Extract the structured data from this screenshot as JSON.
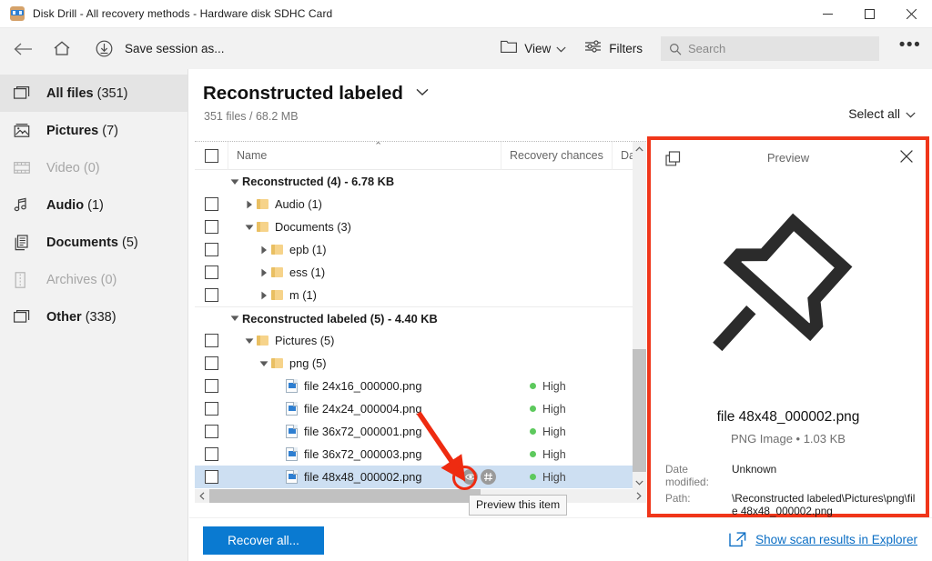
{
  "window": {
    "title": "Disk Drill - All recovery methods - Hardware disk SDHC Card",
    "app_icon": "disk-drill-icon",
    "minimize": "—",
    "maximize": "☐",
    "close": "✕"
  },
  "toolbar": {
    "back_icon": "back-arrow-icon",
    "home_icon": "home-icon",
    "save_icon": "save-download-icon",
    "save_label": "Save session as...",
    "view_label": "View",
    "view_icon": "folder-icon",
    "filters_label": "Filters",
    "filters_icon": "sliders-icon",
    "search_placeholder": "Search",
    "search_value": "",
    "search_icon": "search-icon",
    "more_label": "•••"
  },
  "sidebar": {
    "items": [
      {
        "label": "All files",
        "count": "(351)",
        "icon": "all-files-icon",
        "active": true,
        "disabled": false
      },
      {
        "label": "Pictures",
        "count": "(7)",
        "icon": "picture-icon",
        "active": false,
        "disabled": false
      },
      {
        "label": "Video",
        "count": "(0)",
        "icon": "film-icon",
        "active": false,
        "disabled": true
      },
      {
        "label": "Audio",
        "count": "(1)",
        "icon": "music-note-icon",
        "active": false,
        "disabled": false
      },
      {
        "label": "Documents",
        "count": "(5)",
        "icon": "documents-icon",
        "active": false,
        "disabled": false
      },
      {
        "label": "Archives",
        "count": "(0)",
        "icon": "archive-icon",
        "active": false,
        "disabled": true
      },
      {
        "label": "Other",
        "count": "(338)",
        "icon": "other-icon",
        "active": false,
        "disabled": false
      }
    ]
  },
  "content": {
    "title": "Reconstructed labeled",
    "subtitle": "351 files / 68.2 MB",
    "select_all": "Select all"
  },
  "table": {
    "headers": {
      "name": "Name",
      "recovery": "Recovery chances",
      "date": "Date"
    },
    "sort_caret": "⌃",
    "rows": [
      {
        "type": "group",
        "label": "Reconstructed (4) - 6.78 KB",
        "expanded": true,
        "indent": 0
      },
      {
        "type": "folder",
        "label": "Audio (1)",
        "expanded": false,
        "indent": 1
      },
      {
        "type": "folder",
        "label": "Documents (3)",
        "expanded": true,
        "indent": 1
      },
      {
        "type": "folder",
        "label": "epb (1)",
        "expanded": false,
        "indent": 2
      },
      {
        "type": "folder",
        "label": "ess (1)",
        "expanded": false,
        "indent": 2
      },
      {
        "type": "folder",
        "label": "m (1)",
        "expanded": false,
        "indent": 2
      },
      {
        "type": "group",
        "label": "Reconstructed labeled (5) - 4.40 KB",
        "expanded": true,
        "indent": 0
      },
      {
        "type": "folder",
        "label": "Pictures (5)",
        "expanded": true,
        "indent": 1
      },
      {
        "type": "folder",
        "label": "png (5)",
        "expanded": true,
        "indent": 2
      },
      {
        "type": "file",
        "label": "file 24x16_000000.png",
        "recovery": "High",
        "indent": 3,
        "selected": false
      },
      {
        "type": "file",
        "label": "file 24x24_000004.png",
        "recovery": "High",
        "indent": 3,
        "selected": false
      },
      {
        "type": "file",
        "label": "file 36x72_000001.png",
        "recovery": "High",
        "indent": 3,
        "selected": false
      },
      {
        "type": "file",
        "label": "file 36x72_000003.png",
        "recovery": "High",
        "indent": 3,
        "selected": false
      },
      {
        "type": "file",
        "label": "file 48x48_000002.png",
        "recovery": "High",
        "indent": 3,
        "selected": true
      }
    ]
  },
  "tooltip": {
    "text": "Preview this item"
  },
  "row_actions": {
    "preview_icon": "eye-icon",
    "hash_icon": "hash-icon"
  },
  "preview": {
    "header_title": "Preview",
    "copy_icon": "copy-icon",
    "close_icon": "close-icon",
    "image_icon": "pushpin-image",
    "file_name": "file 48x48_000002.png",
    "file_meta": "PNG Image • 1.03 KB",
    "fields": [
      {
        "key": "Date modified:",
        "value": "Unknown"
      },
      {
        "key": "Path:",
        "value": "\\Reconstructed labeled\\Pictures\\png\\file 48x48_000002.png"
      }
    ]
  },
  "bottom": {
    "recover_label": "Recover all...",
    "explorer_label": "Show scan results in Explorer",
    "explorer_icon": "external-link-icon"
  },
  "colors": {
    "accent_blue": "#0a7ad1",
    "link_blue": "#0b6ec4",
    "annotation_red": "#f0361a",
    "selection_blue": "#cddff2",
    "high_green": "#5dc95d",
    "folder_yellow": "#f6d38a"
  }
}
